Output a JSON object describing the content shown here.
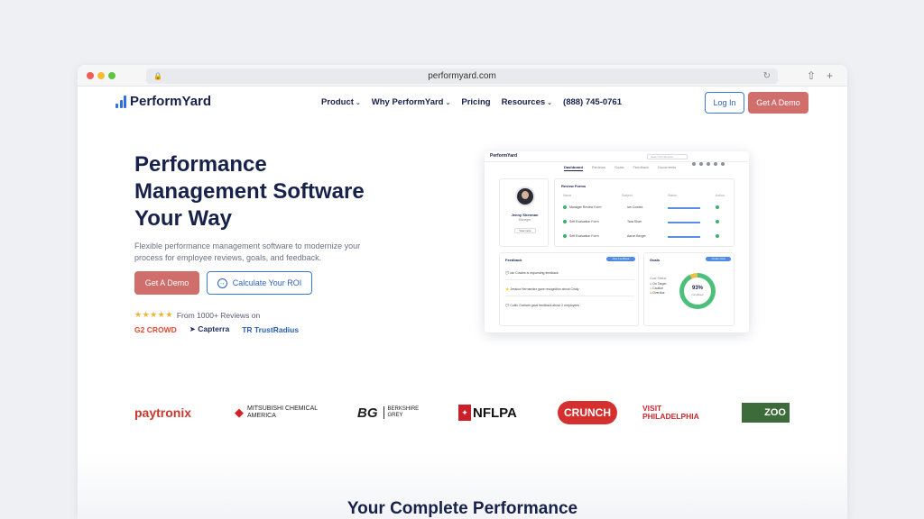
{
  "browser": {
    "url": "performyard.com"
  },
  "nav": {
    "logo": "PerformYard",
    "items": [
      {
        "label": "Product",
        "dropdown": true
      },
      {
        "label": "Why PerformYard",
        "dropdown": true
      },
      {
        "label": "Pricing",
        "dropdown": false
      },
      {
        "label": "Resources",
        "dropdown": true
      },
      {
        "label": "(888) 745-0761",
        "dropdown": false
      }
    ],
    "login": "Log In",
    "demo": "Get A Demo"
  },
  "hero": {
    "title": "Performance Management Software Your Way",
    "subtitle": "Flexible performance management software to modernize your process for employee reviews, goals, and feedback.",
    "cta_primary": "Get A Demo",
    "cta_secondary": "Calculate Your ROI",
    "stars": "★★★★★",
    "reviews_text": "From 1000+ Reviews on",
    "review_sites": [
      "CROWD",
      "Capterra",
      "TrustRadius"
    ]
  },
  "dashboard": {
    "logo": "PerformYard",
    "search_placeholder": "Search Employees",
    "tabs": [
      "Dashboard",
      "Reviews",
      "Goals",
      "Feedback",
      "Documents"
    ],
    "profile": {
      "name": "Jenny Sherman",
      "role": "Manager",
      "button": "View more"
    },
    "review_forms": {
      "title": "Review Forms",
      "headers": [
        "Name",
        "Subject",
        "Status",
        "Action"
      ],
      "rows": [
        {
          "name": "Manager Review Form",
          "subject": "Ian Cowles"
        },
        {
          "name": "Self Evaluation Form",
          "subject": "Tara Shah"
        },
        {
          "name": "Self Evaluation Form",
          "subject": "Aaron Berger"
        }
      ]
    },
    "feedback": {
      "title": "Feedback",
      "button": "Give Feedback",
      "items": [
        "Ian Cowles is requesting feedback",
        "Jessica Hernandez gave recognition about Cindy",
        "Collin Graham gave feedback about 2 employees"
      ]
    },
    "goals": {
      "title": "Goals",
      "button": "Create Goal",
      "legend_title": "Goal Status",
      "legend": [
        "On Target",
        "Caution",
        "Overdue"
      ],
      "percent": "93%",
      "percent_caption": "completed"
    }
  },
  "logos": {
    "paytronix": "paytronix",
    "mitsubishi": [
      "MITSUBISHI CHEMICAL",
      "AMERICA"
    ],
    "bg_mark": "BG",
    "berkshire": [
      "BERKSHIRE",
      "GREY"
    ],
    "nflpa": "NFLPA",
    "crunch": "CRUNCH",
    "visit": [
      "VISIT",
      "PHILADELPHIA"
    ],
    "zoo": "ZOO"
  },
  "section": {
    "title": "Your Complete Performance"
  }
}
